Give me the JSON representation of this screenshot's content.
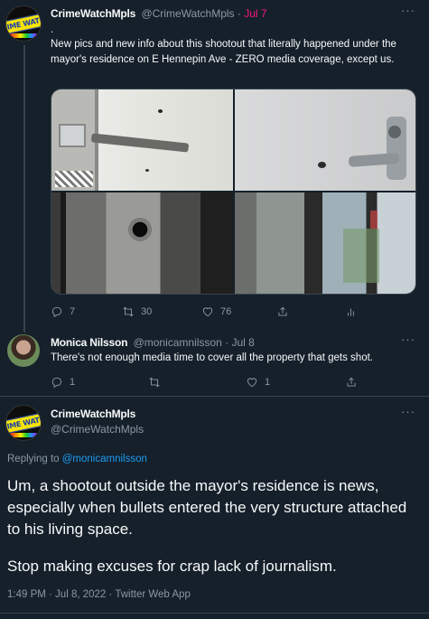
{
  "tweet1": {
    "display_name": "CrimeWatchMpls",
    "handle": "@CrimeWatchMpls",
    "separator": "·",
    "date": "Jul 7",
    "dot_line": ".",
    "text": "New pics and new info about this shootout that literally happened under the mayor's residence on E Hennepin Ave - ZERO media coverage, except us.",
    "replies": "7",
    "retweets": "30",
    "likes": "76",
    "avatar_badge": "CRIME WATCH"
  },
  "tweet2": {
    "display_name": "Monica Nilsson",
    "handle": "@monicamnilsson",
    "separator": "·",
    "date": "Jul 8",
    "text": "There's not enough media time to cover all the property that gets shot.",
    "replies": "1",
    "retweets": "",
    "likes": "1"
  },
  "tweet3": {
    "display_name": "CrimeWatchMpls",
    "handle": "@CrimeWatchMpls",
    "replying_prefix": "Replying to",
    "replying_handle": "@monicamnilsson",
    "text_p1": "Um, a shootout outside the mayor's residence is news, especially when bullets entered the very structure attached to his living space.",
    "text_p2": "Stop making excuses for crap lack of journalism.",
    "timestamp": "1:49 PM · Jul 8, 2022 · Twitter Web App",
    "avatar_badge": "CRIME WATCH"
  },
  "icons": [
    "more-icon",
    "reply-icon",
    "retweet-icon",
    "like-icon",
    "share-icon",
    "analytics-icon"
  ],
  "colors": {
    "background": "#15202b",
    "link": "#1d9bf0",
    "muted": "#8b98a5",
    "date_accent": "#f91880"
  }
}
